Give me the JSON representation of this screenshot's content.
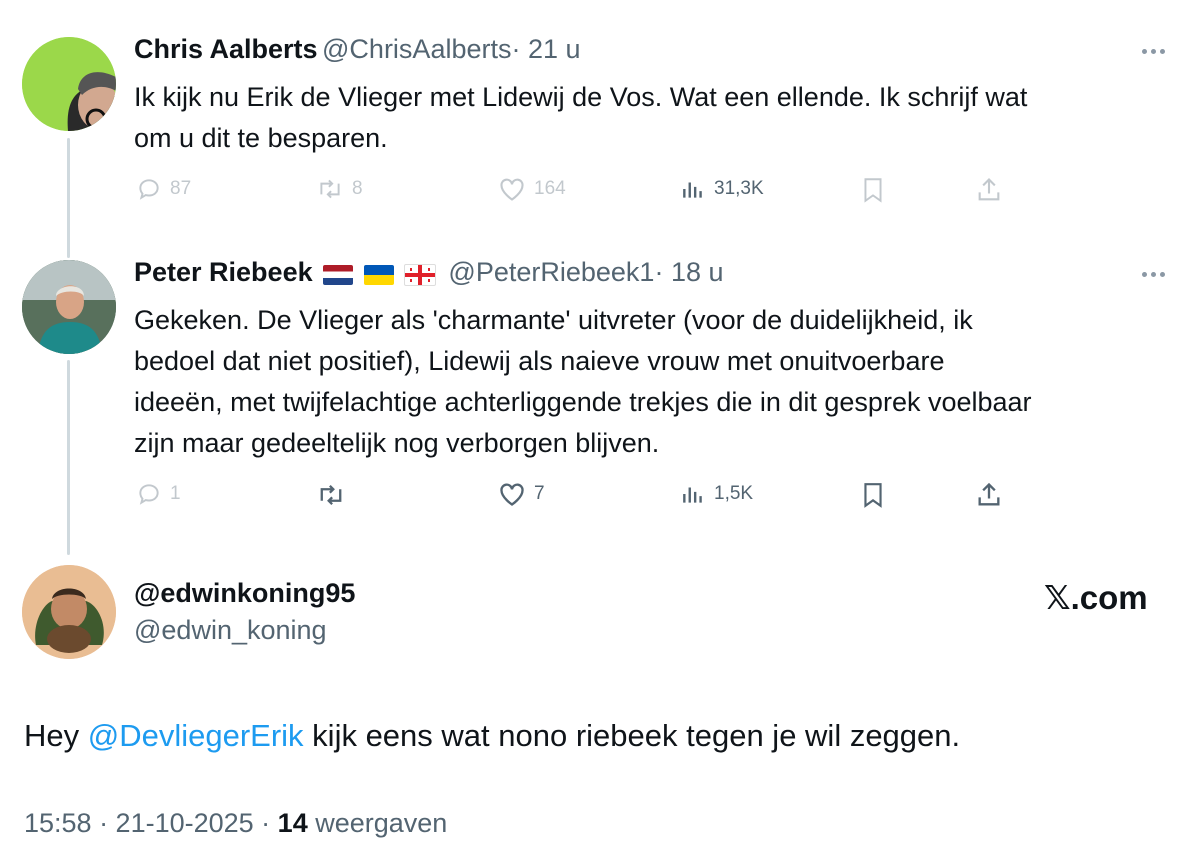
{
  "tweets": [
    {
      "name": "Chris Aalberts",
      "handle": "@ChrisAalberts",
      "time": "· 21 u",
      "text_line1": "Ik kijk nu Erik de Vlieger met Lidewij de Vos. Wat een ellende. Ik schrijf wat",
      "text_line2": "om u dit te besparen.",
      "replies": "87",
      "reposts": "8",
      "likes": "164",
      "views": "31,3K"
    },
    {
      "name": "Peter Riebeek",
      "handle": "@PeterRiebeek1",
      "time": "· 18 u",
      "text_line1": "Gekeken. De Vlieger als 'charmante' uitvreter (voor de duidelijkheid, ik",
      "text_line2": "bedoel dat niet positief), Lidewij als naieve vrouw met onuitvoerbare",
      "text_line3": "ideeën, met twijfelachtige achterliggende trekjes die in dit gesprek voelbaar",
      "text_line4": "zijn maar gedeeltelijk nog verborgen blijven.",
      "replies": "1",
      "likes": "7",
      "views": "1,5K"
    }
  ],
  "main": {
    "display_name": "@edwinkoning95",
    "handle": "@edwin_koning",
    "brand": "𝕏.com",
    "text_before": "Hey ",
    "mention": "@DevliegerErik",
    "text_after": " kijk eens wat nono riebeek tegen je wil zeggen.",
    "time": "15:58 · 21-10-2025 · ",
    "views_count": "14",
    "views_label": " weergaven"
  },
  "colors": {
    "accent": "#1d9bf0",
    "secondary": "#536471",
    "thread": "#cfd9de"
  }
}
